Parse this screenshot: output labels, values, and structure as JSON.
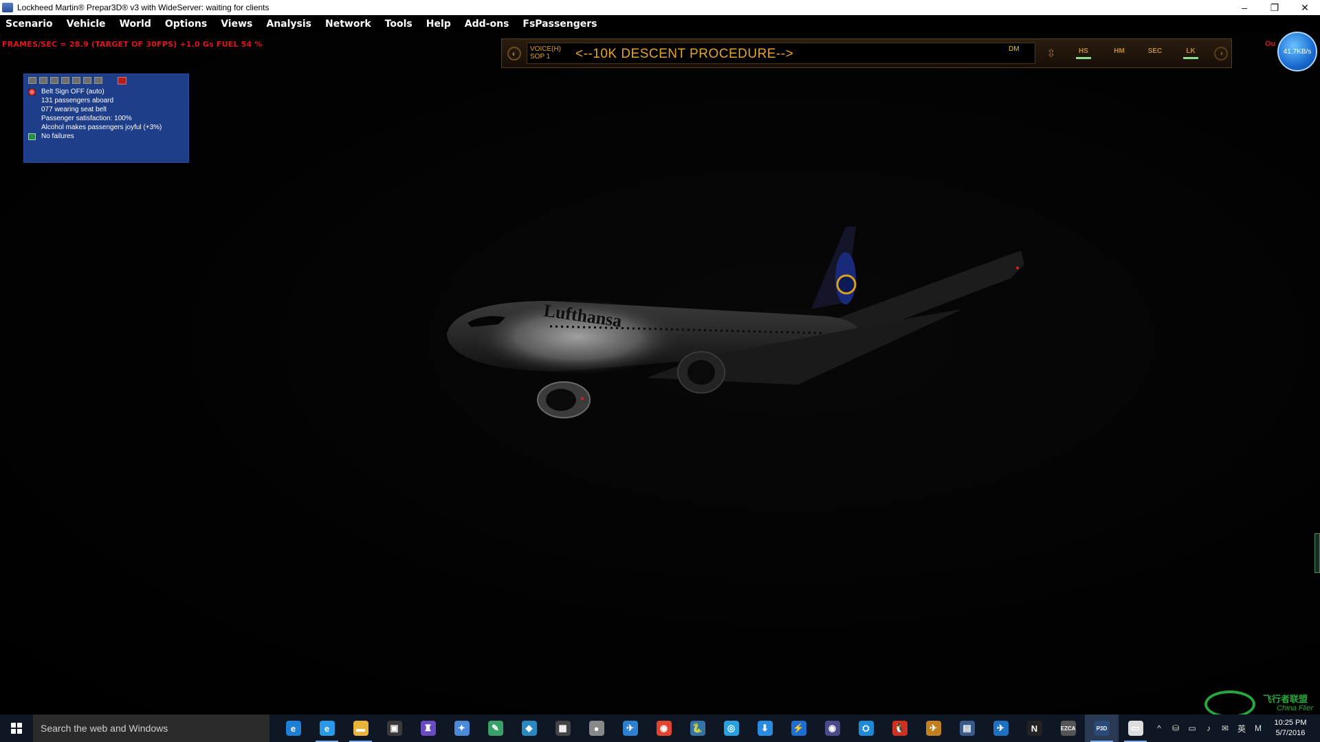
{
  "window": {
    "title": "Lockheed Martin® Prepar3D® v3 with WideServer: waiting for clients",
    "controls": [
      "–",
      "❐",
      "✕"
    ]
  },
  "menu": [
    "Scenario",
    "Vehicle",
    "World",
    "Options",
    "Views",
    "Analysis",
    "Network",
    "Tools",
    "Help",
    "Add-ons",
    "FsPassengers"
  ],
  "hud": {
    "fps_line": "FRAMES/SEC = 28.9   (TARGET OF 30FPS)   +1.0 Gs   FUEL 54 %",
    "out_text": "Ou"
  },
  "fspassengers_panel": {
    "lines": [
      {
        "icon": "belt-icon",
        "text": "Belt Sign OFF (auto)"
      },
      {
        "icon": "",
        "text": "131 passengers aboard"
      },
      {
        "icon": "",
        "text": "077 wearing seat belt"
      },
      {
        "icon": "",
        "text": "Passenger satisfaction: 100%"
      },
      {
        "icon": "",
        "text": "Alcohol makes passengers joyful (+3%)"
      },
      {
        "icon": "ok-icon",
        "text": "No failures"
      }
    ]
  },
  "sop_bar": {
    "voice_label": "VOICE(H)",
    "sop_label": "SOP 1",
    "message": "<--10K DESCENT PROCEDURE-->",
    "dm_label": "DM",
    "buttons": [
      {
        "label": "HS",
        "active": true
      },
      {
        "label": "HM",
        "active": false
      },
      {
        "label": "SEC",
        "active": false
      },
      {
        "label": "LK",
        "active": true
      }
    ]
  },
  "network": {
    "speed": "41.7KB/s"
  },
  "aircraft": {
    "livery": "Lufthansa"
  },
  "taskbar": {
    "search_placeholder": "Search the web and Windows",
    "apps": [
      {
        "name": "edge",
        "glyph": "e",
        "color": "#1e7fd6",
        "open": false
      },
      {
        "name": "ie",
        "glyph": "e",
        "color": "#2a9ae6",
        "open": true
      },
      {
        "name": "explorer",
        "glyph": "▬",
        "color": "#e8b43a",
        "open": true
      },
      {
        "name": "store",
        "glyph": "▣",
        "color": "#3a3a3a",
        "open": false
      },
      {
        "name": "app-5",
        "glyph": "♜",
        "color": "#6a4bc2",
        "open": false
      },
      {
        "name": "app-6",
        "glyph": "✦",
        "color": "#4a8ad6",
        "open": false
      },
      {
        "name": "app-7",
        "glyph": "✎",
        "color": "#3aa06a",
        "open": false
      },
      {
        "name": "app-8",
        "glyph": "◆",
        "color": "#2a88c0",
        "open": false
      },
      {
        "name": "calculator",
        "glyph": "▦",
        "color": "#444",
        "open": false
      },
      {
        "name": "app-10",
        "glyph": "●",
        "color": "#888",
        "open": false
      },
      {
        "name": "app-11",
        "glyph": "✈",
        "color": "#2d7fd0",
        "open": false
      },
      {
        "name": "chrome",
        "glyph": "◉",
        "color": "#e0442e",
        "open": false
      },
      {
        "name": "python",
        "glyph": "🐍",
        "color": "#3572a5",
        "open": false
      },
      {
        "name": "app-14",
        "glyph": "◎",
        "color": "#27a1e0",
        "open": false
      },
      {
        "name": "app-15",
        "glyph": "⬇",
        "color": "#2a8ae0",
        "open": false
      },
      {
        "name": "app-16",
        "glyph": "⚡",
        "color": "#1e6fd0",
        "open": false
      },
      {
        "name": "app-17",
        "glyph": "◉",
        "color": "#4a4a8a",
        "open": false
      },
      {
        "name": "app-18",
        "glyph": "⛭",
        "color": "#1e8ad6",
        "open": false
      },
      {
        "name": "app-19",
        "glyph": "🐧",
        "color": "#d03020",
        "open": false
      },
      {
        "name": "app-20",
        "glyph": "✈",
        "color": "#c08020",
        "open": false
      },
      {
        "name": "app-21",
        "glyph": "▤",
        "color": "#3a5a8a",
        "open": false
      },
      {
        "name": "app-22",
        "glyph": "✈",
        "color": "#1e70c0",
        "open": false
      },
      {
        "name": "app-23",
        "glyph": "N",
        "color": "#222",
        "open": false
      },
      {
        "name": "ezca",
        "glyph": "EZCA",
        "color": "#555",
        "open": false
      },
      {
        "name": "p3d",
        "glyph": "P3D",
        "color": "#2a4b7a",
        "open": true,
        "active": true
      },
      {
        "name": "app-26",
        "glyph": "▭",
        "color": "#ddd",
        "open": true
      }
    ],
    "tray": [
      "^",
      "⛁",
      "▭",
      "♪",
      "✉",
      "英",
      "M"
    ],
    "time": "10:25 PM",
    "date": "5/7/2016"
  },
  "watermark": {
    "text": "飞行者联盟",
    "sub": "China Flier"
  }
}
